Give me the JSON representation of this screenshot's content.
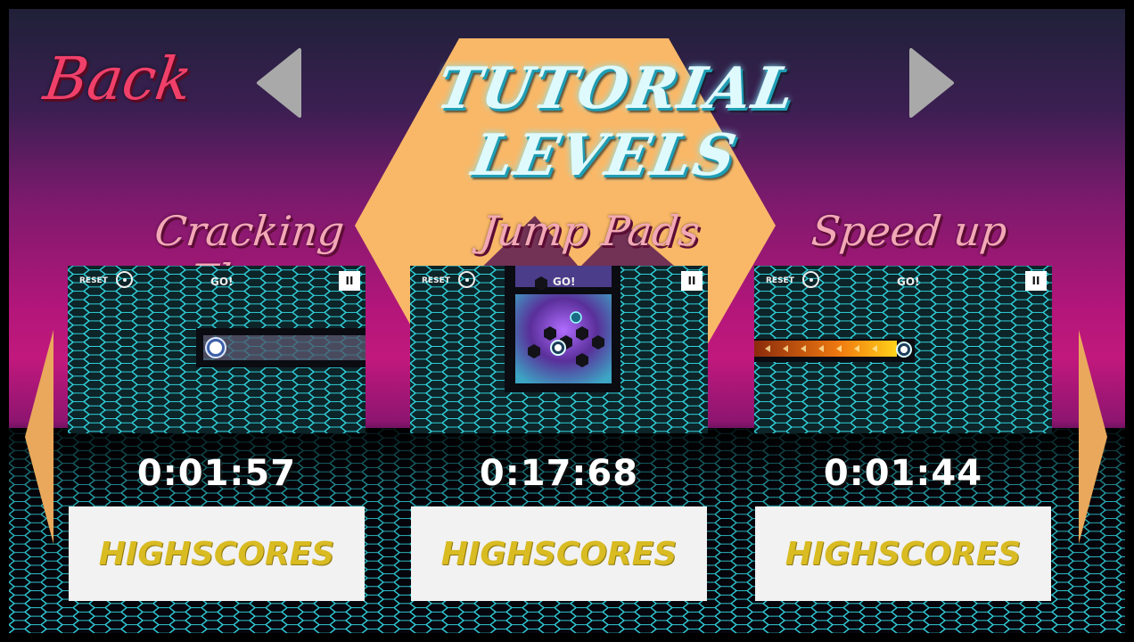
{
  "header": {
    "back_label": "Back",
    "title": "TUTORIAL LEVELS",
    "prev_icon": "triangle-left-icon",
    "next_icon": "triangle-right-icon"
  },
  "colors": {
    "title_text": "#dffafd",
    "back_text": "#f0406a",
    "level_name": "#f3a8b6",
    "highscore_text": "#d9bb22",
    "sun": "#f9b868",
    "grid": "#2fd6e0"
  },
  "levels": [
    {
      "name": "Cracking Floor",
      "time": "0:01:57",
      "highscores_label": "HIGHSCORES",
      "thumb": {
        "reset_label": "RESET",
        "go_label": "GO!",
        "pause_label": "II"
      }
    },
    {
      "name": "Jump Pads",
      "time": "0:17:68",
      "highscores_label": "HIGHSCORES",
      "thumb": {
        "reset_label": "RESET",
        "go_label": "GO!",
        "pause_label": "II"
      }
    },
    {
      "name": "Speed up",
      "time": "0:01:44",
      "highscores_label": "HIGHSCORES",
      "thumb": {
        "reset_label": "RESET",
        "go_label": "GO!",
        "pause_label": "II"
      }
    }
  ],
  "carousel": {
    "prev_icon": "chevron-left-icon",
    "next_icon": "chevron-right-icon"
  }
}
